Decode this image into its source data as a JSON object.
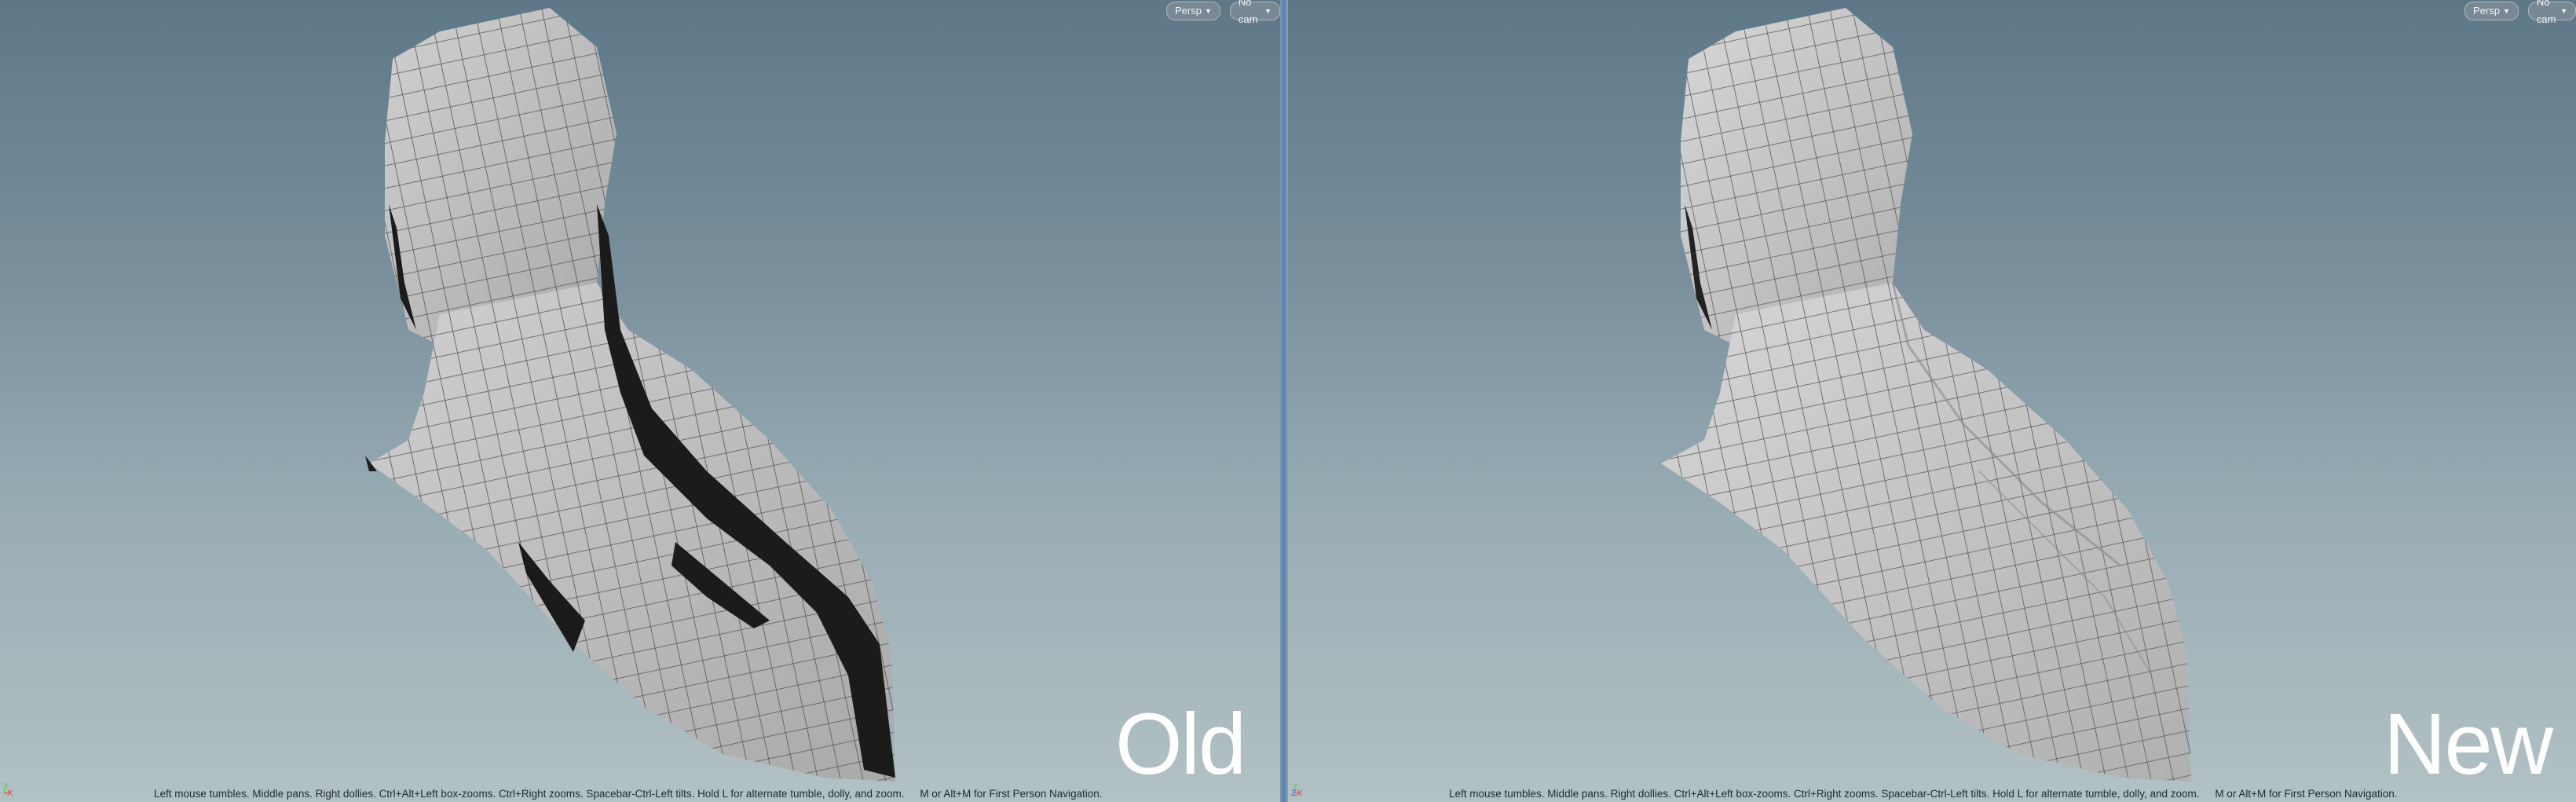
{
  "viewports": [
    {
      "id": "left",
      "menus": {
        "projection_label": "Persp",
        "camera_label": "No cam"
      },
      "overlay_label": "Old",
      "help": {
        "controls": "Left mouse tumbles. Middle pans. Right dollies. Ctrl+Alt+Left box-zooms. Ctrl+Right zooms. Spacebar-Ctrl-Left tilts. Hold L for alternate tumble, dolly, and zoom.",
        "navigation": "M or Alt+M for First Person Navigation."
      },
      "axis": {
        "y": "Y",
        "x": "X"
      }
    },
    {
      "id": "right",
      "menus": {
        "projection_label": "Persp",
        "camera_label": "No cam"
      },
      "overlay_label": "New",
      "help": {
        "controls": "Left mouse tumbles. Middle pans. Right dollies. Ctrl+Alt+Left box-zooms. Ctrl+Right zooms. Spacebar-Ctrl-Left tilts. Hold L for alternate tumble, dolly, and zoom.",
        "navigation": "M or Alt+M for First Person Navigation."
      },
      "axis": {
        "y": "Y",
        "z": "Z",
        "x": "X"
      }
    }
  ],
  "colors": {
    "mesh_fill": "#bdbdbd",
    "mesh_wire": "#5a5a5a",
    "mesh_dark": "#1b1b1b",
    "divider": "#5c86b5"
  }
}
